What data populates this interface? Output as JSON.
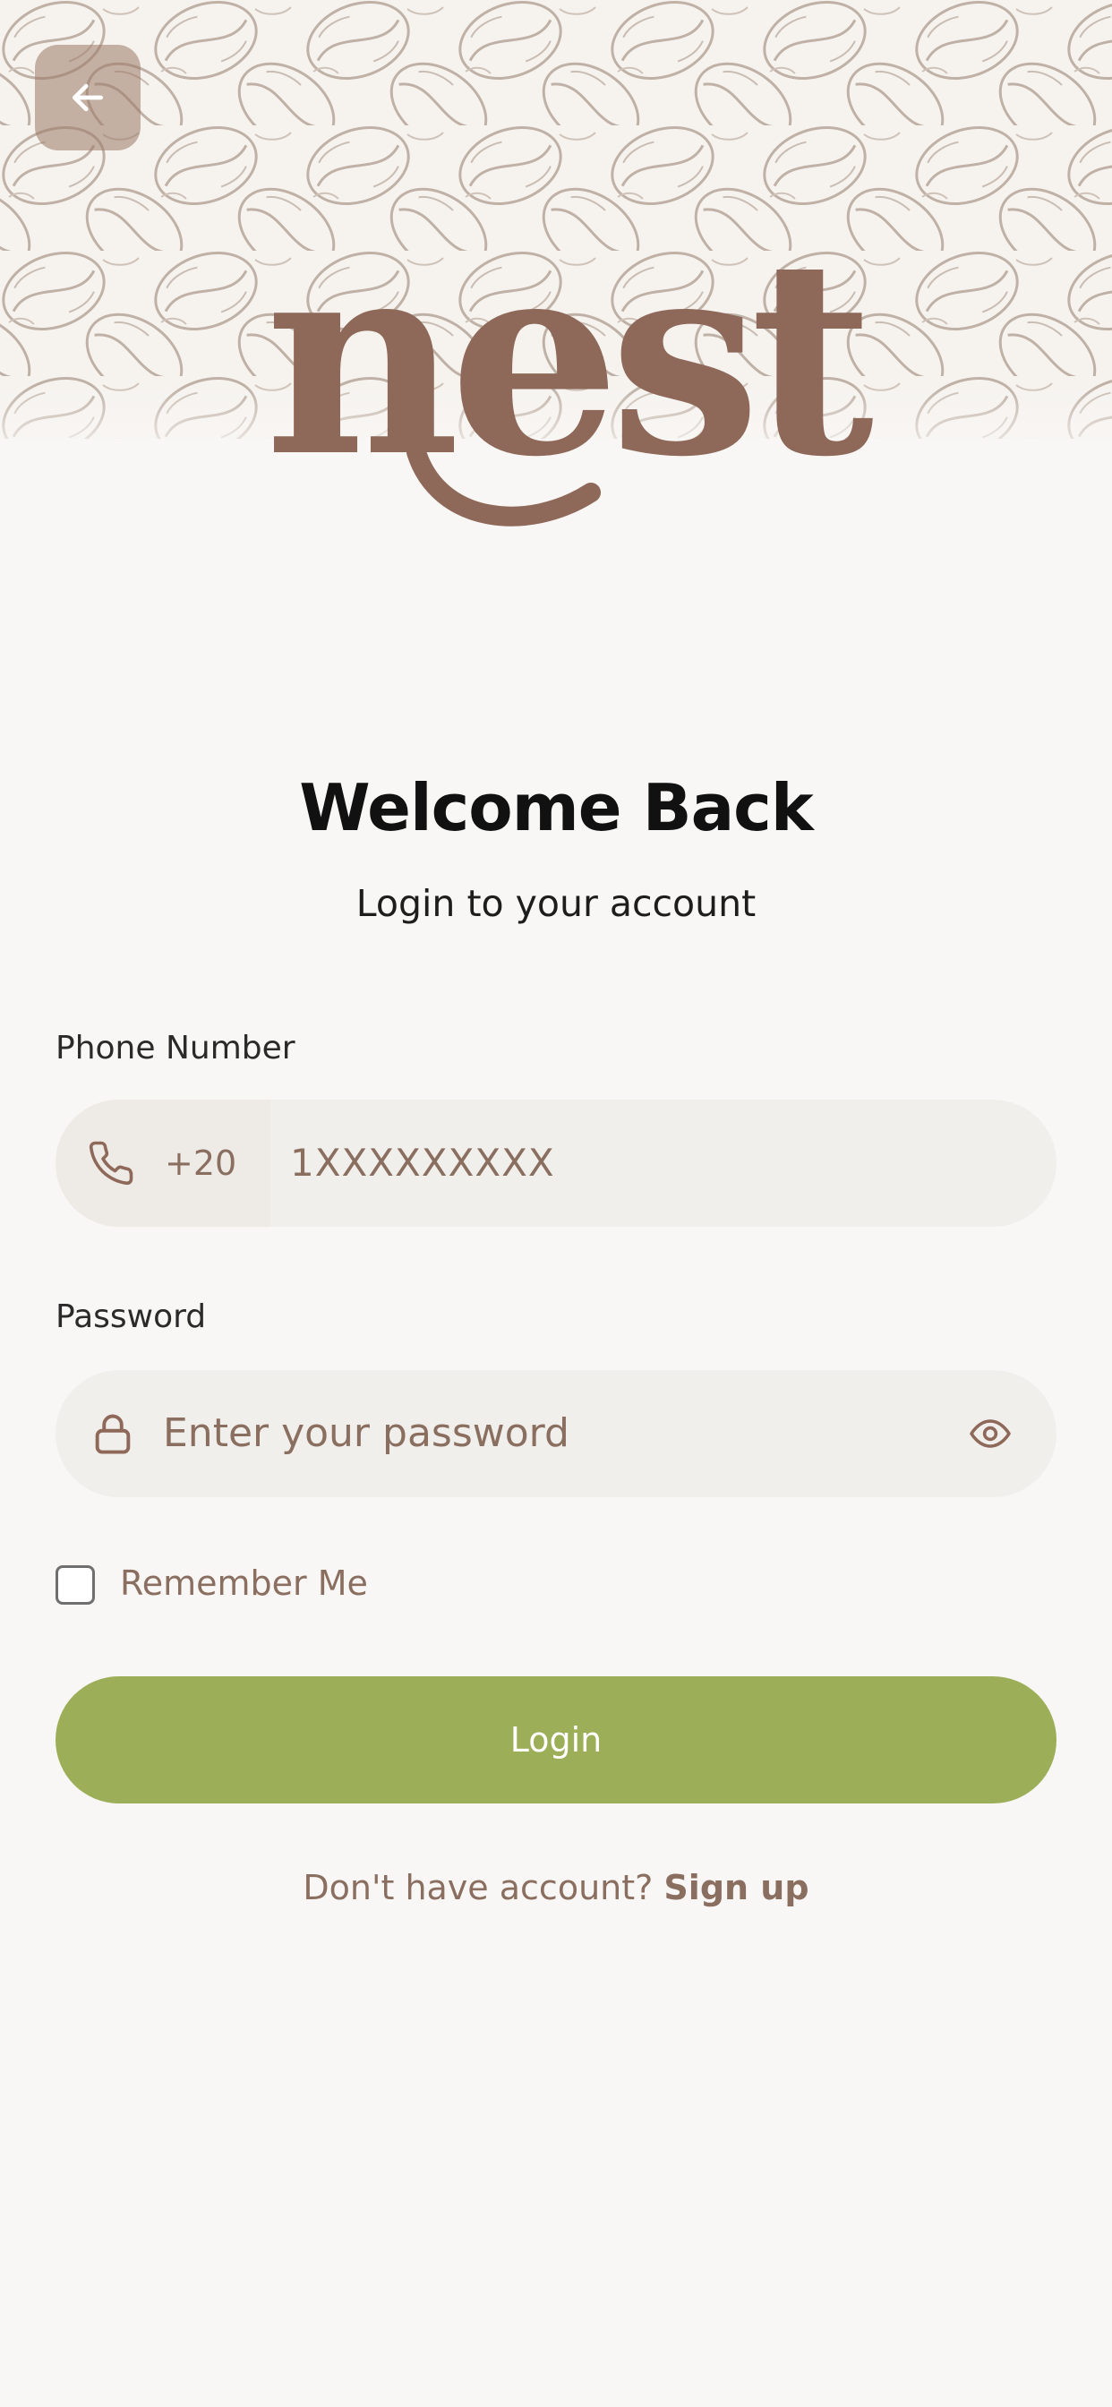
{
  "header": {
    "back_icon": "arrow-left-icon",
    "logo_text": "nest"
  },
  "welcome": {
    "title": "Welcome Back",
    "subtitle": "Login to your account"
  },
  "phone": {
    "label": "Phone Number",
    "icon": "phone-icon",
    "country_code": "+20",
    "placeholder": "1XXXXXXXXX"
  },
  "password": {
    "label": "Password",
    "icon": "lock-icon",
    "placeholder": "Enter your password",
    "toggle_icon": "eye-icon"
  },
  "remember": {
    "label": "Remember Me",
    "checked": false
  },
  "login": {
    "button_label": "Login"
  },
  "signup": {
    "prompt": "Don't have account?",
    "link_label": "Sign up"
  },
  "colors": {
    "background": "#f9f7f5",
    "brand_brown": "#8e6858",
    "accent_green": "#9caf58",
    "input_bg": "#f1efec",
    "muted_text": "#8a6e5f"
  }
}
